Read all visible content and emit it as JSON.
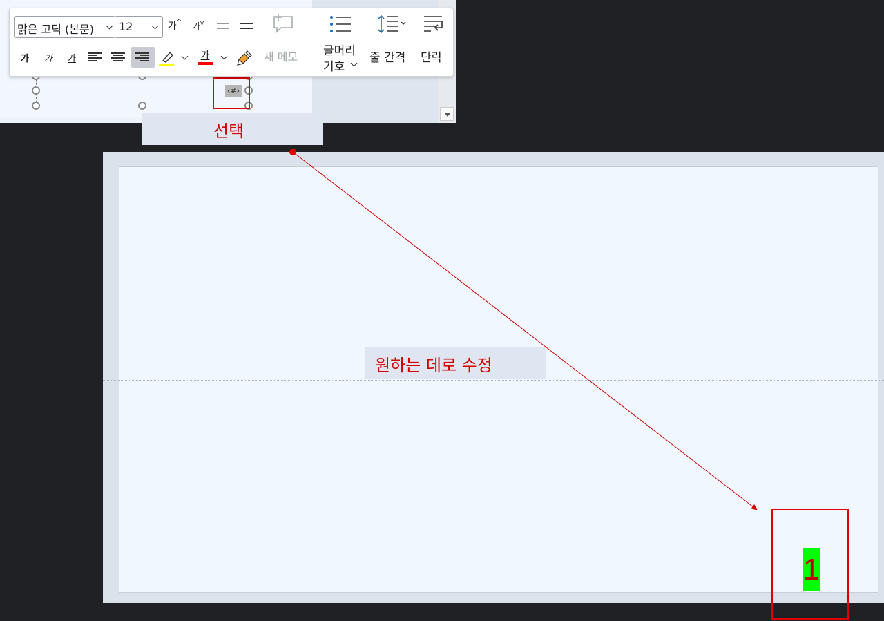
{
  "toolbar": {
    "font_name": "맑은 고딕 (본문)",
    "font_size": "12",
    "grow_font": "가",
    "shrink_font": "가",
    "bold": "가",
    "italic": "가",
    "underline": "가",
    "font_color_glyph": "가",
    "new_memo": "새 메모",
    "bullets_line1": "글머리",
    "bullets_line2": "기호",
    "line_spacing": "줄 간격",
    "paragraph": "단락",
    "highlight_color": "#ffff00",
    "font_color": "#ff0000"
  },
  "thumbnail": {
    "field_code": "‹#›"
  },
  "annotations": {
    "select_label": "선택",
    "edit_label": "원하는 데로 수정",
    "page_number": "1",
    "accent_color": "#e00000",
    "page_number_bg": "#00ff00"
  }
}
